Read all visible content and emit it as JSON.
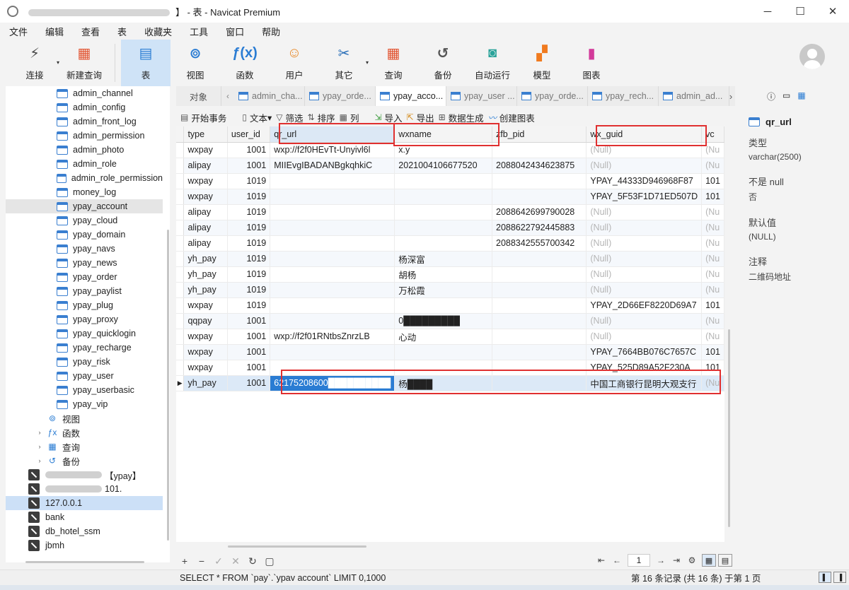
{
  "window": {
    "title": "】 - 表 - Navicat Premium",
    "controls": [
      "─",
      "☐",
      "✕"
    ]
  },
  "menu": [
    "文件",
    "编辑",
    "查看",
    "表",
    "收藏夹",
    "工具",
    "窗口",
    "帮助"
  ],
  "toolbar": {
    "items": [
      {
        "label": "连接",
        "icon": "plug-icon",
        "color": "#4a4a4a",
        "glyph": "⚡",
        "caret": true
      },
      {
        "label": "新建查询",
        "icon": "new-query-icon",
        "color": "#e2522f",
        "glyph": "▦",
        "caret": false
      },
      {
        "label": "表",
        "icon": "table-icon",
        "color": "#2a7cd3",
        "glyph": "▤",
        "caret": false,
        "active": true
      },
      {
        "label": "视图",
        "icon": "view-icon",
        "color": "#2a7cd3",
        "glyph": "⊚",
        "caret": false
      },
      {
        "label": "函数",
        "icon": "function-icon",
        "color": "#2a7cd3",
        "glyph": "ƒ(x)",
        "caret": false
      },
      {
        "label": "用户",
        "icon": "user-icon",
        "color": "#e88a2a",
        "glyph": "☺",
        "caret": false
      },
      {
        "label": "其它",
        "icon": "tools-icon",
        "color": "#2a6fb8",
        "glyph": "✂",
        "caret": true
      },
      {
        "label": "查询",
        "icon": "query-icon",
        "color": "#e2522f",
        "glyph": "▦",
        "caret": false
      },
      {
        "label": "备份",
        "icon": "backup-icon",
        "color": "#555555",
        "glyph": "↺",
        "caret": false
      },
      {
        "label": "自动运行",
        "icon": "robot-icon",
        "color": "#2aa39a",
        "glyph": "◙",
        "caret": false
      },
      {
        "label": "模型",
        "icon": "model-icon",
        "color": "#f07a1e",
        "glyph": "▞",
        "caret": false
      },
      {
        "label": "图表",
        "icon": "chart-icon",
        "color": "#d23a9a",
        "glyph": "▮",
        "caret": false
      }
    ]
  },
  "sidebar": {
    "tables": [
      "admin_channel",
      "admin_config",
      "admin_front_log",
      "admin_permission",
      "admin_photo",
      "admin_role",
      "admin_role_permission",
      "money_log",
      "ypay_account",
      "ypay_cloud",
      "ypay_domain",
      "ypay_navs",
      "ypay_news",
      "ypay_order",
      "ypay_paylist",
      "ypay_plug",
      "ypay_proxy",
      "ypay_quicklogin",
      "ypay_recharge",
      "ypay_risk",
      "ypay_user",
      "ypay_userbasic",
      "ypay_vip"
    ],
    "selected_table": "ypay_account",
    "groups": [
      {
        "label": "视图",
        "glyph": "⊚",
        "expandable": false
      },
      {
        "label": "函数",
        "glyph": "ƒx",
        "expandable": true
      },
      {
        "label": "查询",
        "glyph": "▦",
        "expandable": true
      },
      {
        "label": "备份",
        "glyph": "↺",
        "expandable": true
      }
    ],
    "connections": [
      {
        "label": "【ypay】",
        "blurred": true
      },
      {
        "label": "101.",
        "blurred": true
      },
      {
        "label": "127.0.0.1",
        "blurred": false,
        "selected": true
      },
      {
        "label": "bank",
        "blurred": false
      },
      {
        "label": "db_hotel_ssm",
        "blurred": false
      },
      {
        "label": "jbmh",
        "blurred": false
      }
    ]
  },
  "tabs": {
    "object_label": "对象",
    "items": [
      "admin_cha...",
      "ypay_orde...",
      "ypay_acco...",
      "ypay_user ...",
      "ypay_orde...",
      "ypay_rech...",
      "admin_ad..."
    ],
    "active_index": 2
  },
  "subtoolbar": [
    "开始事务",
    "文本",
    "筛选",
    "排序",
    "列",
    "导入",
    "导出",
    "数据生成",
    "创建图表"
  ],
  "grid": {
    "columns": [
      "type",
      "user_id",
      "qr_url",
      "wxname",
      "zfb_pid",
      "wx_guid",
      "vc"
    ],
    "rows": [
      [
        "wxpay",
        "1001",
        "wxp://f2f0HEvTt-Unyivl6l",
        "x.y",
        "",
        "(Null)",
        "(Nu"
      ],
      [
        "alipay",
        "1001",
        "MIIEvgIBADANBgkqhkiC",
        "2021004106677520",
        "2088042434623875",
        "(Null)",
        "(Nu"
      ],
      [
        "wxpay",
        "1019",
        "",
        "",
        "",
        "YPAY_44333D946968F87",
        "101"
      ],
      [
        "wxpay",
        "1019",
        "",
        "",
        "",
        "YPAY_5F53F1D71ED507D",
        "101"
      ],
      [
        "alipay",
        "1019",
        "",
        "",
        "2088642699790028",
        "(Null)",
        "(Nu"
      ],
      [
        "alipay",
        "1019",
        "",
        "",
        "2088622792445883",
        "(Null)",
        "(Nu"
      ],
      [
        "alipay",
        "1019",
        "",
        "",
        "2088342555700342",
        "(Null)",
        "(Nu"
      ],
      [
        "yh_pay",
        "1019",
        "",
        "杨深富",
        "",
        "(Null)",
        "(Nu"
      ],
      [
        "yh_pay",
        "1019",
        "",
        "胡杨",
        "",
        "(Null)",
        "(Nu"
      ],
      [
        "yh_pay",
        "1019",
        "",
        "万松霞",
        "",
        "(Null)",
        "(Nu"
      ],
      [
        "wxpay",
        "1019",
        "",
        "",
        "",
        "YPAY_2D66EF8220D69A7",
        "101"
      ],
      [
        "qqpay",
        "1001",
        "",
        "0█████████",
        "",
        "(Null)",
        "(Nu"
      ],
      [
        "wxpay",
        "1001",
        "wxp://f2f01RNtbsZnrzLB",
        "心动",
        "",
        "(Null)",
        "(Nu"
      ],
      [
        "wxpay",
        "1001",
        "",
        "",
        "",
        "YPAY_7664BB076C7657C",
        "101"
      ],
      [
        "wxpay",
        "1001",
        "",
        "",
        "",
        "YPAY_525D89A52F230A",
        "101"
      ],
      [
        "yh_pay",
        "1001",
        "62175208600██████████",
        "杨████",
        "",
        "中国工商银行昆明大观支行",
        "(Nu"
      ]
    ],
    "current_row": 15
  },
  "pager": {
    "page": "1"
  },
  "right_panel": {
    "field_name": "qr_url",
    "type_label": "类型",
    "type_value": "varchar(2500)",
    "notnull_label": "不是 null",
    "notnull_value": "否",
    "default_label": "默认值",
    "default_value": "(NULL)",
    "comment_label": "注释",
    "comment_value": "二维码地址"
  },
  "status": {
    "sql": "SELECT * FROM `pay`.`ypav account` LIMIT 0,1000",
    "records": "第 16 条记录 (共 16 条) 于第 1 页"
  }
}
